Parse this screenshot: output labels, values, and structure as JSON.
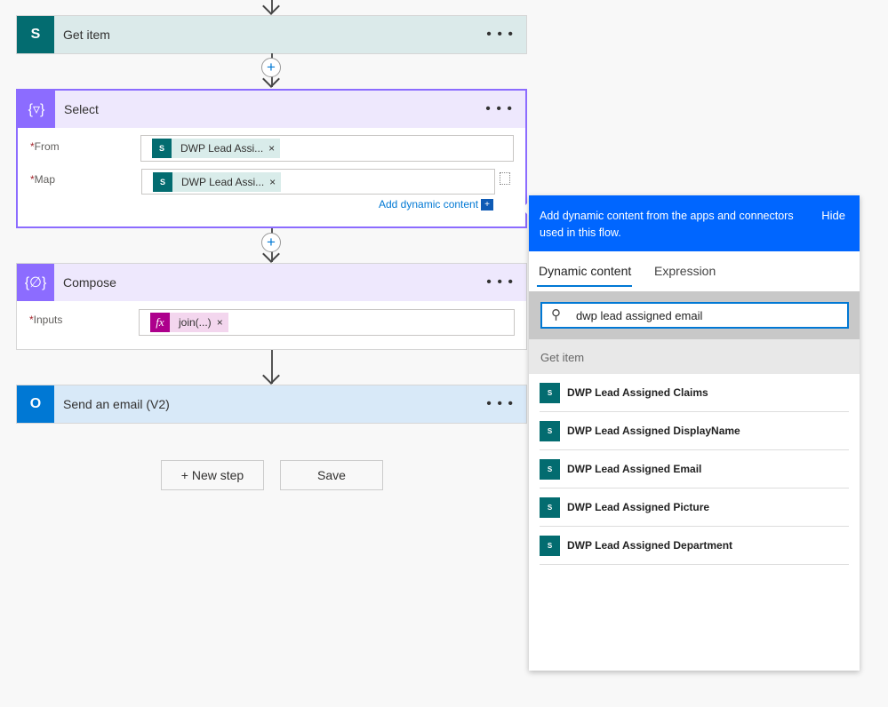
{
  "flow": {
    "top_arrow": true,
    "get_item": {
      "title": "Get item",
      "icon": "sharepoint-icon",
      "more": "• • •"
    },
    "select": {
      "title": "Select",
      "icon": "select-braces-icon",
      "more": "• • •",
      "from_label": "From",
      "from_token": "DWP Lead Assi...",
      "map_label": "Map",
      "map_token": "DWP Lead Assi...",
      "add_dynamic": "Add dynamic content",
      "required": "*"
    },
    "compose": {
      "title": "Compose",
      "icon": "compose-braces-icon",
      "more": "• • •",
      "inputs_label": "Inputs",
      "inputs_token": "join(...)",
      "fx": "fx",
      "required": "*"
    },
    "send_email": {
      "title": "Send an email (V2)",
      "icon": "outlook-icon",
      "more": "• • •"
    },
    "new_step": "+ New step",
    "save": "Save",
    "token_close": "×",
    "sp_letter": "S"
  },
  "panel": {
    "header_text": "Add dynamic content from the apps and connectors used in this flow.",
    "hide": "Hide",
    "tabs": [
      {
        "label": "Dynamic content",
        "active": true
      },
      {
        "label": "Expression",
        "active": false
      }
    ],
    "search_value": "dwp lead assigned email",
    "section": "Get item",
    "items": [
      {
        "label": "DWP Lead Assigned Claims"
      },
      {
        "label": "DWP Lead Assigned DisplayName"
      },
      {
        "label": "DWP Lead Assigned Email"
      },
      {
        "label": "DWP Lead Assigned Picture"
      },
      {
        "label": "DWP Lead Assigned Department"
      }
    ]
  },
  "colors": {
    "sharepoint": "#036c70",
    "select": "#8c6cff",
    "outlook": "#0078d4",
    "panel_header": "#0066ff",
    "expression": "#ad008c"
  }
}
